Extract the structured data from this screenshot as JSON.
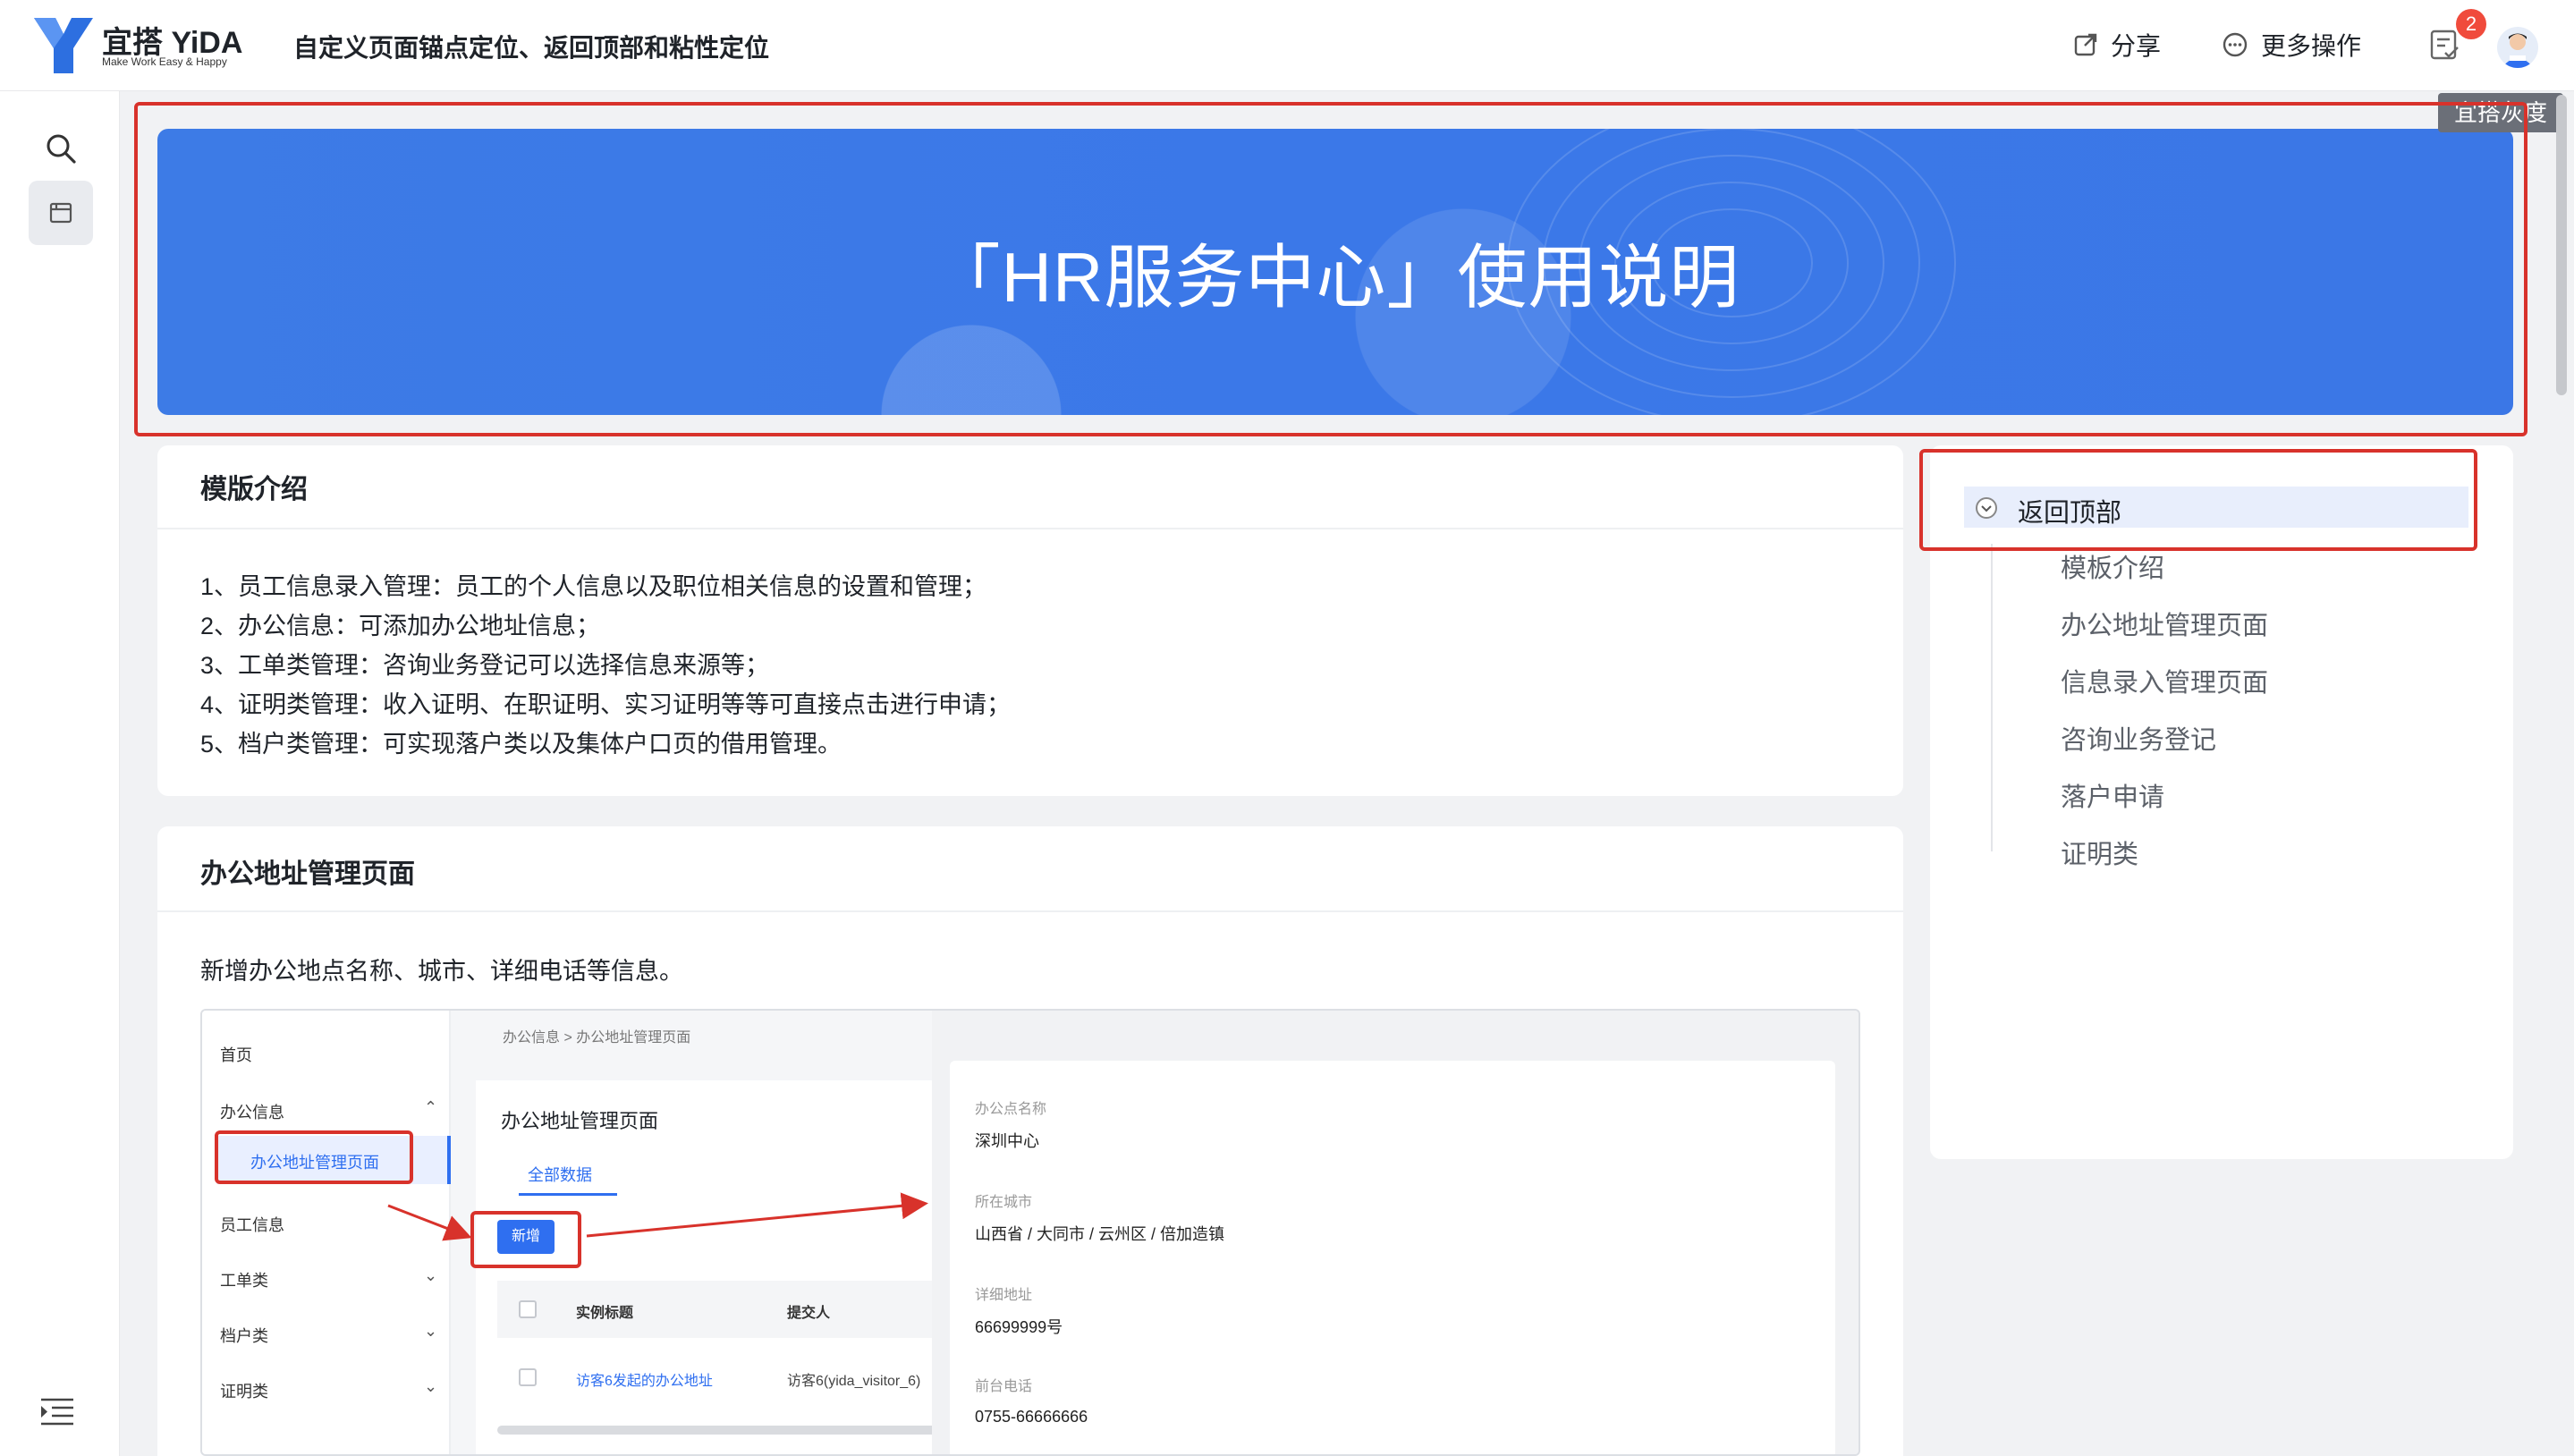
{
  "header": {
    "logo_name": "宜搭 YiDA",
    "logo_tagline": "Make Work Easy & Happy",
    "page_title": "自定义页面锚点定位、返回顶部和粘性定位",
    "share_label": "分享",
    "more_label": "更多操作",
    "todo_badge": "2",
    "avatar_text": "用户"
  },
  "rail": {
    "icons": [
      "search-icon",
      "page-icon",
      "collapse-icon"
    ]
  },
  "banner": {
    "title": "「HR服务中心」使用说明",
    "gray_tag": "宜搭灰度"
  },
  "intro": {
    "title": "模版介绍",
    "lines": [
      "1、员工信息录入管理：员工的个人信息以及职位相关信息的设置和管理；",
      "2、办公信息：可添加办公地址信息；",
      "3、工单类管理：咨询业务登记可以选择信息来源等；",
      "4、证明类管理：收入证明、在职证明、实习证明等等可直接点击进行申请；",
      "5、档户类管理：可实现落户类以及集体户口页的借用管理。"
    ]
  },
  "office": {
    "title": "办公地址管理页面",
    "description": "新增办公地点名称、城市、详细电话等信息。"
  },
  "anchor_nav": {
    "top_label": "返回顶部",
    "items": [
      "模板介绍",
      "办公地址管理页面",
      "信息录入管理页面",
      "咨询业务登记",
      "落户申请",
      "证明类"
    ]
  },
  "screenshot": {
    "nav": [
      "首页",
      "办公信息",
      "办公地址管理页面",
      "员工信息",
      "工单类",
      "档户类",
      "证明类"
    ],
    "breadcrumb": "办公信息   >   办公地址管理页面",
    "panel_title": "办公地址管理页面",
    "tab": "全部数据",
    "new_button": "新增",
    "col_title": "实例标题",
    "col_submitter": "提交人",
    "row_title": "访客6发起的办公地址",
    "row_submitter": "访客6(yida_visitor_6)",
    "fields": [
      {
        "label": "办公点名称",
        "value": "深圳中心"
      },
      {
        "label": "所在城市",
        "value": "山西省 / 大同市 / 云州区 / 倍加造镇"
      },
      {
        "label": "详细地址",
        "value": "66699999号"
      },
      {
        "label": "前台电话",
        "value": "0755-66666666"
      }
    ]
  },
  "colors": {
    "banner_blue": "#3b78e8",
    "annotation_red": "#d8322b",
    "link_blue": "#2f6ff0",
    "badge_red": "#f04b3c"
  }
}
